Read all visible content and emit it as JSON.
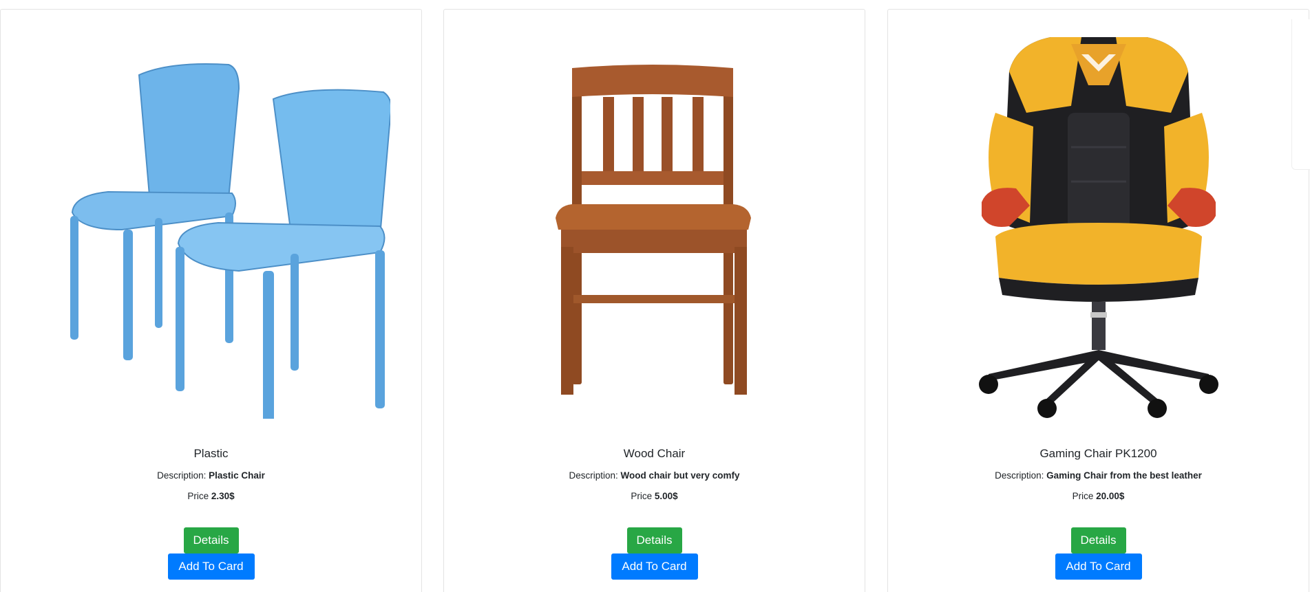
{
  "products": [
    {
      "name": "Plastic",
      "description_label": "Description:",
      "description": "Plastic Chair",
      "price_label": "Price",
      "price": "2.30$",
      "details_label": "Details",
      "add_label": "Add To Card",
      "image_icon": "blue-plastic-chairs-image",
      "color": "#5ea9e6"
    },
    {
      "name": "Wood Chair",
      "description_label": "Description:",
      "description": "Wood chair but very comfy",
      "price_label": "Price",
      "price": "5.00$",
      "details_label": "Details",
      "add_label": "Add To Card",
      "image_icon": "wooden-chair-image",
      "color": "#a2542a"
    },
    {
      "name": "Gaming Chair PK1200",
      "description_label": "Description:",
      "description": "Gaming Chair from the best leather",
      "price_label": "Price",
      "price": "20.00$",
      "details_label": "Details",
      "add_label": "Add To Card",
      "image_icon": "gaming-chair-image",
      "color": "#f4b42a"
    }
  ],
  "colors": {
    "details_button": "#28a745",
    "add_button": "#007bff"
  }
}
